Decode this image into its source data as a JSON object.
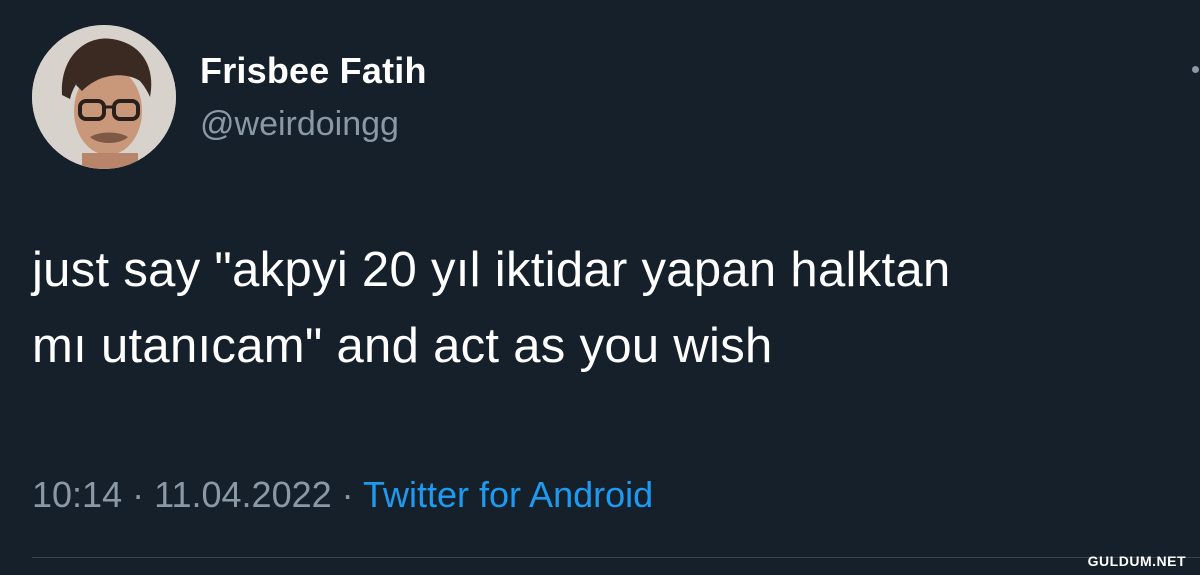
{
  "tweet": {
    "author": {
      "display_name": "Frisbee Fatih",
      "handle": "@weirdoingg",
      "avatar_icon": "user-avatar-photo"
    },
    "text_lines": [
      "just say \"akpyi 20 yıl iktidar yapan halktan",
      "mı utanıcam\" and act as you wish"
    ],
    "time": "10:14",
    "separator": "·",
    "date": "11.04.2022",
    "source": "Twitter for Android"
  },
  "watermark": "GULDUM.NET",
  "colors": {
    "background": "#15202b",
    "primary_text": "#ffffff",
    "secondary_text": "#8b98a5",
    "link": "#1d9bf0",
    "divider": "#38444d"
  }
}
